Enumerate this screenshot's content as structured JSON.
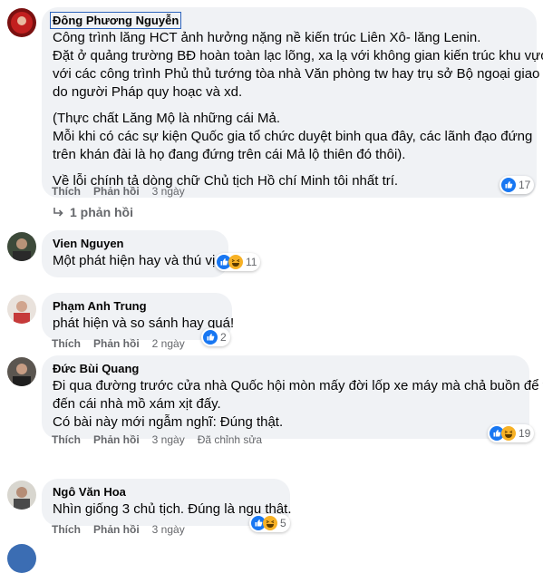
{
  "comments": [
    {
      "author": "Đông Phương Nguyễn",
      "paragraphs": [
        [
          "Công trình lăng HCT ảnh hưởng nặng nề kiến trúc Liên Xô- lăng Lenin.",
          "Đặt ở quảng trường BĐ hoàn toàn lạc lõng, xa lạ với không gian kiến trúc khu vực-",
          "với các công trình Phủ thủ tướng tòa nhà Văn phòng tw hay trụ sở Bộ ngoại giao",
          "do người Pháp quy hoạc và xd."
        ],
        [
          "(Thực chất Lăng Mộ là những cái Mả.",
          "Mỗi khi có các sự kiện Quốc gia tổ chức duyệt binh qua đây, các lãnh đạo đứng",
          "trên khán đài là họ đang đứng trên cái Mả lộ thiên đó thôi)."
        ],
        [
          "Về lỗi chính tả dòng chữ Chủ tịch Hồ chí Minh tôi nhất trí."
        ]
      ],
      "like_label": "Thích",
      "reply_label": "Phản hồi",
      "time": "3 ngày",
      "reactions": [
        "like"
      ],
      "reaction_count": "17",
      "replies_label": "1 phản hồi"
    },
    {
      "author": "Vien Nguyen",
      "paragraphs": [
        [
          "Một phát hiện hay và thú vị."
        ]
      ],
      "reactions": [
        "like",
        "haha"
      ],
      "reaction_count": "11"
    },
    {
      "author": "Phạm Anh Trung",
      "paragraphs": [
        [
          "phát hiện và so sánh hay quá!"
        ]
      ],
      "like_label": "Thích",
      "reply_label": "Phản hồi",
      "time": "2 ngày",
      "reactions": [
        "like"
      ],
      "reaction_count": "2"
    },
    {
      "author": "Đức Bùi Quang",
      "paragraphs": [
        [
          "Đi qua đường trước cửa nhà Quốc hội mòn mấy đời lốp xe máy mà chả buồn để ý",
          "đến cái nhà mồ xám xịt đấy.",
          "Có bài này mới ngẫm nghĩ: Đúng thật."
        ]
      ],
      "like_label": "Thích",
      "reply_label": "Phản hồi",
      "time": "3 ngày",
      "edited": "Đã chỉnh sửa",
      "reactions": [
        "like",
        "haha"
      ],
      "reaction_count": "19"
    },
    {
      "author": "Ngô Văn Hoa",
      "paragraphs": [
        [
          "Nhìn giống 3 chủ tịch. Đúng là ngu thật."
        ]
      ],
      "like_label": "Thích",
      "reply_label": "Phản hồi",
      "time": "3 ngày",
      "reactions": [
        "like",
        "haha"
      ],
      "reaction_count": "5"
    }
  ],
  "colors": {
    "bubble": "#f0f2f5",
    "meta_text": "#65676b",
    "like_blue": "#1877f2",
    "haha_yellow": "#f7b125"
  }
}
